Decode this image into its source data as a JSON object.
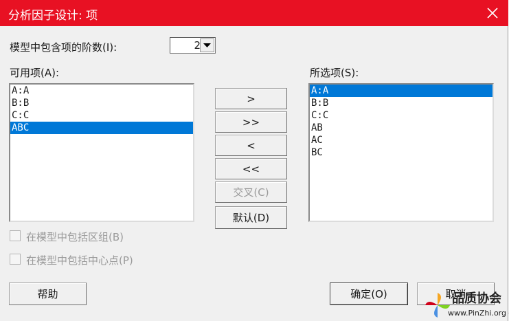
{
  "window": {
    "title": "分析因子设计: 项"
  },
  "order": {
    "label": "模型中包含项的阶数(I):",
    "value": "2"
  },
  "available": {
    "label": "可用项(A):",
    "items": [
      {
        "text": "A:A",
        "selected": false
      },
      {
        "text": "B:B",
        "selected": false
      },
      {
        "text": "C:C",
        "selected": false
      },
      {
        "text": "ABC",
        "selected": true
      }
    ]
  },
  "selected_terms": {
    "label": "所选项(S):",
    "items": [
      {
        "text": "A:A",
        "selected": true
      },
      {
        "text": "B:B",
        "selected": false
      },
      {
        "text": "C:C",
        "selected": false
      },
      {
        "text": "AB",
        "selected": false
      },
      {
        "text": "AC",
        "selected": false
      },
      {
        "text": "BC",
        "selected": false
      }
    ]
  },
  "transfer": {
    "add": ">",
    "add_all": ">>",
    "remove": "<",
    "remove_all": "<<",
    "cross": "交叉(C)",
    "default": "默认(D)"
  },
  "options": {
    "blocks": {
      "label": "在模型中包括区组(B)",
      "checked": false,
      "enabled": false
    },
    "center": {
      "label": "在模型中包括中心点(P)",
      "checked": false,
      "enabled": false
    }
  },
  "footer": {
    "help": "帮助",
    "ok": "确定(O)",
    "cancel": "取消"
  },
  "watermark": {
    "name": "品质协会",
    "url": "www.PinZhi.org"
  },
  "colors": {
    "titlebar": "#e81123",
    "selection": "#0078d7"
  }
}
